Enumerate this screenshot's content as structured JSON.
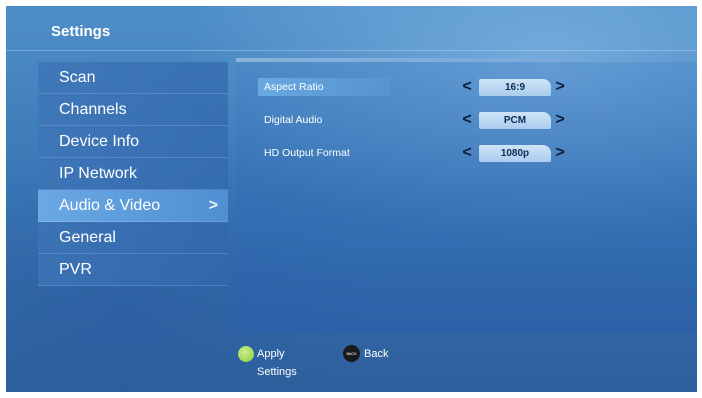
{
  "header": {
    "title": "Settings"
  },
  "sidebar": {
    "items": [
      {
        "label": "Scan"
      },
      {
        "label": "Channels"
      },
      {
        "label": "Device Info"
      },
      {
        "label": "IP Network"
      },
      {
        "label": "Audio & Video"
      },
      {
        "label": "General"
      },
      {
        "label": "PVR"
      }
    ],
    "arrow": ">"
  },
  "settings": [
    {
      "label": "Aspect Ratio",
      "value": "16:9"
    },
    {
      "label": "Digital Audio",
      "value": "PCM"
    },
    {
      "label": "HD Output Format",
      "value": "1080p"
    }
  ],
  "chevrons": {
    "left": "<",
    "right": ">"
  },
  "footer": {
    "apply_label": "Apply Settings",
    "back_icon_text": "BACK",
    "back_label": "Back"
  },
  "colors": {
    "background_top": "#4f8fc8",
    "background_bottom": "#2e5f9c",
    "selection": "#6aa9e4",
    "apply_button": "#8ccc3c"
  },
  "icons": [
    "chevron-right-icon",
    "chevron-left-icon",
    "green-button-icon",
    "back-button-icon"
  ]
}
